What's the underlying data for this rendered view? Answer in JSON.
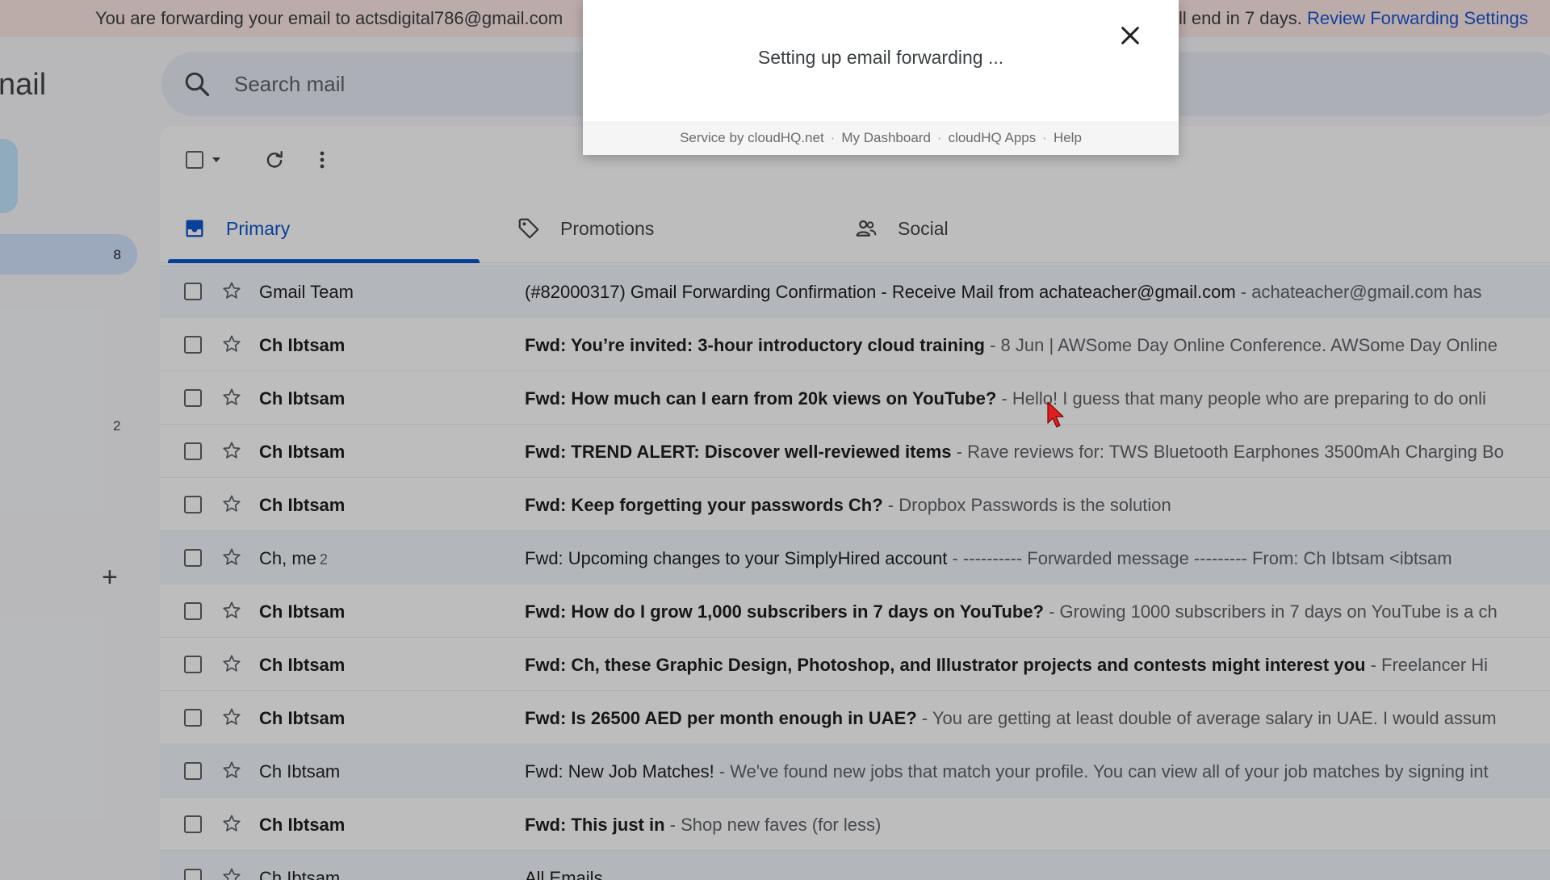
{
  "banner": {
    "text_left": "You are forwarding your email to actsdigital786@gmail.com",
    "text_right": "ll end in 7 days.",
    "link": "Review Forwarding Settings"
  },
  "app": {
    "logo_text": "nail"
  },
  "sidebar": {
    "inbox_count": "8",
    "second_count": "2",
    "add_label": "+"
  },
  "search": {
    "placeholder": "Search mail"
  },
  "tabs": [
    {
      "label": "Primary",
      "icon": "inbox-icon"
    },
    {
      "label": "Promotions",
      "icon": "tag-icon"
    },
    {
      "label": "Social",
      "icon": "people-icon"
    }
  ],
  "emails": [
    {
      "sender": "Gmail Team",
      "count": "",
      "subject": "(#82000317) Gmail Forwarding Confirmation - Receive Mail from achateacher@gmail.com",
      "snippet": " - achateacher@gmail.com has",
      "unread": false
    },
    {
      "sender": "Ch Ibtsam",
      "count": "",
      "subject": "Fwd: You’re invited: 3-hour introductory cloud training",
      "snippet": " - 8 Jun | AWSome Day Online Conference. AWSome Day Online",
      "unread": true
    },
    {
      "sender": "Ch Ibtsam",
      "count": "",
      "subject": "Fwd: How much can I earn from 20k views on YouTube?",
      "snippet": " - Hello! I guess that many people who are preparing to do onli",
      "unread": true
    },
    {
      "sender": "Ch Ibtsam",
      "count": "",
      "subject": "Fwd: TREND ALERT: Discover well-reviewed items",
      "snippet": " - Rave reviews for: TWS Bluetooth Earphones 3500mAh Charging Bo",
      "unread": true
    },
    {
      "sender": "Ch Ibtsam",
      "count": "",
      "subject": "Fwd: Keep forgetting your passwords Ch?",
      "snippet": " - Dropbox Passwords is the solution",
      "unread": true
    },
    {
      "sender": "Ch, me",
      "count": "2",
      "subject": "Fwd: Upcoming changes to your SimplyHired account",
      "snippet": " - ---------- Forwarded message --------- From: Ch Ibtsam <ibtsam",
      "unread": false
    },
    {
      "sender": "Ch Ibtsam",
      "count": "",
      "subject": "Fwd: How do I grow 1,000 subscribers in 7 days on YouTube?",
      "snippet": " - Growing 1000 subscribers in 7 days on YouTube is a ch",
      "unread": true
    },
    {
      "sender": "Ch Ibtsam",
      "count": "",
      "subject": "Fwd: Ch, these Graphic Design, Photoshop, and Illustrator projects and contests might interest you",
      "snippet": " - Freelancer Hi",
      "unread": true
    },
    {
      "sender": "Ch Ibtsam",
      "count": "",
      "subject": "Fwd: Is 26500 AED per month enough in UAE?",
      "snippet": " - You are getting at least double of average salary in UAE. I would assum",
      "unread": true
    },
    {
      "sender": "Ch Ibtsam",
      "count": "",
      "subject": "Fwd: New Job Matches!",
      "snippet": " - We've found new jobs that match your profile. You can view all of your job matches by signing int",
      "unread": false
    },
    {
      "sender": "Ch Ibtsam",
      "count": "",
      "subject": "Fwd: This just in",
      "snippet": " - Shop new faves (for less)",
      "unread": true
    },
    {
      "sender": "Ch Ibtsam",
      "count": "",
      "subject": "All Emails",
      "snippet": "",
      "unread": false
    }
  ],
  "dialog": {
    "message": "Setting up email forwarding ...",
    "footer": {
      "service_by": "Service by cloudHQ.net",
      "dashboard": "My Dashboard",
      "apps": "cloudHQ Apps",
      "help": "Help",
      "separator": "·"
    }
  },
  "colors": {
    "accent": "#0b57d0",
    "banner_bg": "#fce8e6",
    "cursor": "#e02020"
  }
}
